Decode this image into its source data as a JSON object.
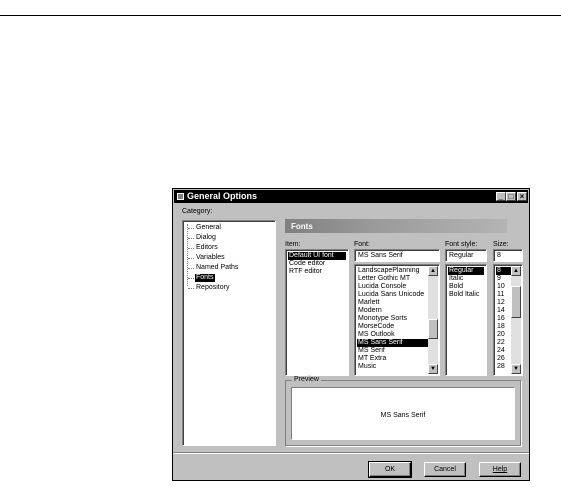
{
  "window": {
    "title": "General Options"
  },
  "labels": {
    "category": "Category:",
    "item": "Item:",
    "font": "Font:",
    "font_style": "Font style:",
    "size": "Size:",
    "preview": "Preview"
  },
  "tree": {
    "items": [
      {
        "label": "General",
        "selected": false
      },
      {
        "label": "Dialog",
        "selected": false
      },
      {
        "label": "Editors",
        "selected": false
      },
      {
        "label": "Variables",
        "selected": false
      },
      {
        "label": "Named Paths",
        "selected": false
      },
      {
        "label": "Fonts",
        "selected": true
      },
      {
        "label": "Repository",
        "selected": false
      }
    ]
  },
  "page_header": "Fonts",
  "item_list": {
    "items": [
      {
        "label": "Default UI font",
        "selected": true
      },
      {
        "label": "Code editor",
        "selected": false
      },
      {
        "label": "RTF editor",
        "selected": false
      }
    ]
  },
  "font": {
    "value": "MS Sans Serif",
    "items": [
      {
        "label": "LandscapePlanning",
        "selected": false
      },
      {
        "label": "Letter Gothic MT",
        "selected": false
      },
      {
        "label": "Lucida Console",
        "selected": false
      },
      {
        "label": "Lucida Sans Unicode",
        "selected": false
      },
      {
        "label": "Marlett",
        "selected": false
      },
      {
        "label": "Modern",
        "selected": false
      },
      {
        "label": "Monotype Sorts",
        "selected": false
      },
      {
        "label": "MorseCode",
        "selected": false
      },
      {
        "label": "MS Outlook",
        "selected": false
      },
      {
        "label": "MS Sans Serif",
        "selected": true
      },
      {
        "label": "MS Serif",
        "selected": false
      },
      {
        "label": "MT Extra",
        "selected": false
      },
      {
        "label": "Music",
        "selected": false
      }
    ]
  },
  "font_style": {
    "value": "Regular",
    "items": [
      {
        "label": "Regular",
        "selected": true
      },
      {
        "label": "Italic",
        "selected": false
      },
      {
        "label": "Bold",
        "selected": false
      },
      {
        "label": "Bold Italic",
        "selected": false
      }
    ]
  },
  "size": {
    "value": "8",
    "items": [
      {
        "label": "8",
        "selected": true
      },
      {
        "label": "9",
        "selected": false
      },
      {
        "label": "10",
        "selected": false
      },
      {
        "label": "11",
        "selected": false
      },
      {
        "label": "12",
        "selected": false
      },
      {
        "label": "14",
        "selected": false
      },
      {
        "label": "16",
        "selected": false
      },
      {
        "label": "18",
        "selected": false
      },
      {
        "label": "20",
        "selected": false
      },
      {
        "label": "22",
        "selected": false
      },
      {
        "label": "24",
        "selected": false
      },
      {
        "label": "26",
        "selected": false
      },
      {
        "label": "28",
        "selected": false
      }
    ]
  },
  "preview_text": "MS Sans Serif",
  "buttons": {
    "ok": "OK",
    "cancel": "Cancel",
    "help": "Help"
  },
  "colors": {
    "selection": "#000000",
    "dialog_bg": "#c0c0c0",
    "titlebar": "#000000"
  }
}
